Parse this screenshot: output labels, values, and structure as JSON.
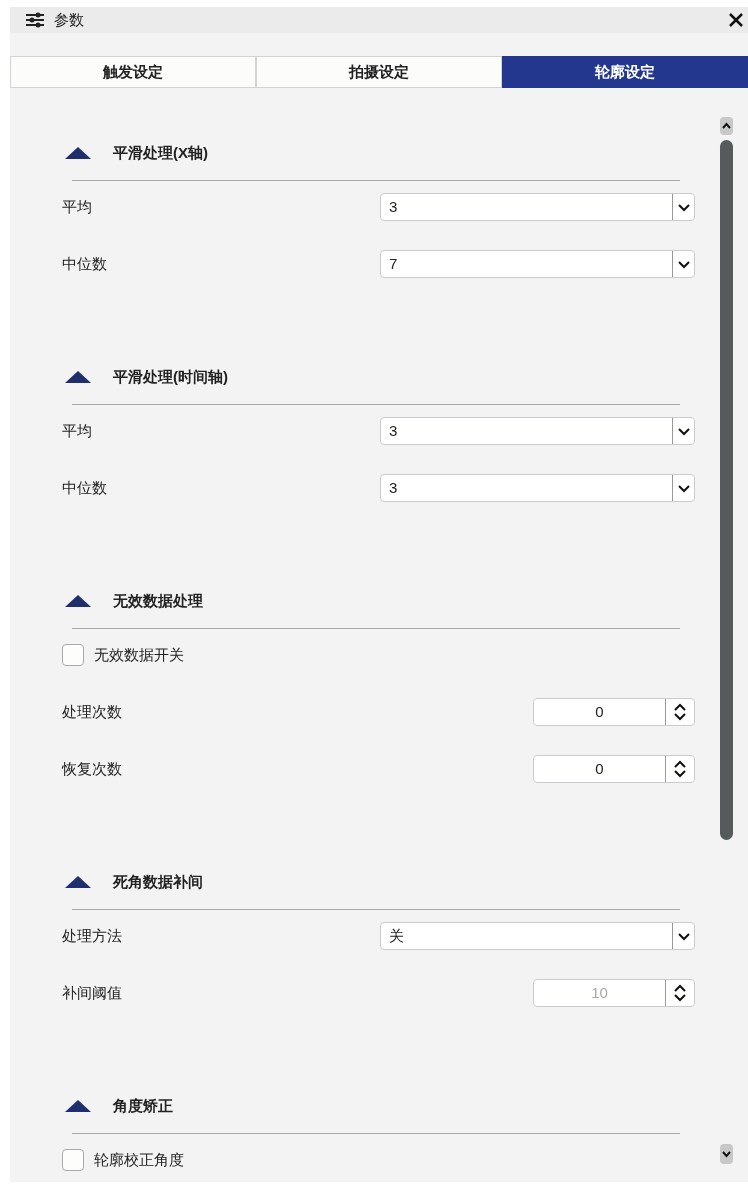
{
  "window": {
    "title": "参数"
  },
  "tabs": [
    {
      "label": "触发设定",
      "selected": false
    },
    {
      "label": "拍摄设定",
      "selected": false
    },
    {
      "label": "轮廓设定",
      "selected": true
    }
  ],
  "sections": [
    {
      "title": "平滑处理(X轴)",
      "expanded": true,
      "items": [
        {
          "kind": "select",
          "label": "平均",
          "value": "3"
        },
        {
          "kind": "select",
          "label": "中位数",
          "value": "7"
        }
      ]
    },
    {
      "title": "平滑处理(时间轴)",
      "expanded": true,
      "items": [
        {
          "kind": "select",
          "label": "平均",
          "value": "3"
        },
        {
          "kind": "select",
          "label": "中位数",
          "value": "3"
        }
      ]
    },
    {
      "title": "无效数据处理",
      "expanded": true,
      "items": [
        {
          "kind": "checkbox",
          "label": "无效数据开关",
          "checked": false
        },
        {
          "kind": "spin",
          "label": "处理次数",
          "value": "0",
          "disabled": false
        },
        {
          "kind": "spin",
          "label": "恢复次数",
          "value": "0",
          "disabled": false
        }
      ]
    },
    {
      "title": "死角数据补间",
      "expanded": true,
      "items": [
        {
          "kind": "select",
          "label": "处理方法",
          "value": "关"
        },
        {
          "kind": "spin",
          "label": "补间阈值",
          "value": "10",
          "disabled": true
        }
      ]
    },
    {
      "title": "角度矫正",
      "expanded": true,
      "items": [
        {
          "kind": "checkbox",
          "label": "轮廓校正角度",
          "checked": false
        }
      ]
    }
  ]
}
